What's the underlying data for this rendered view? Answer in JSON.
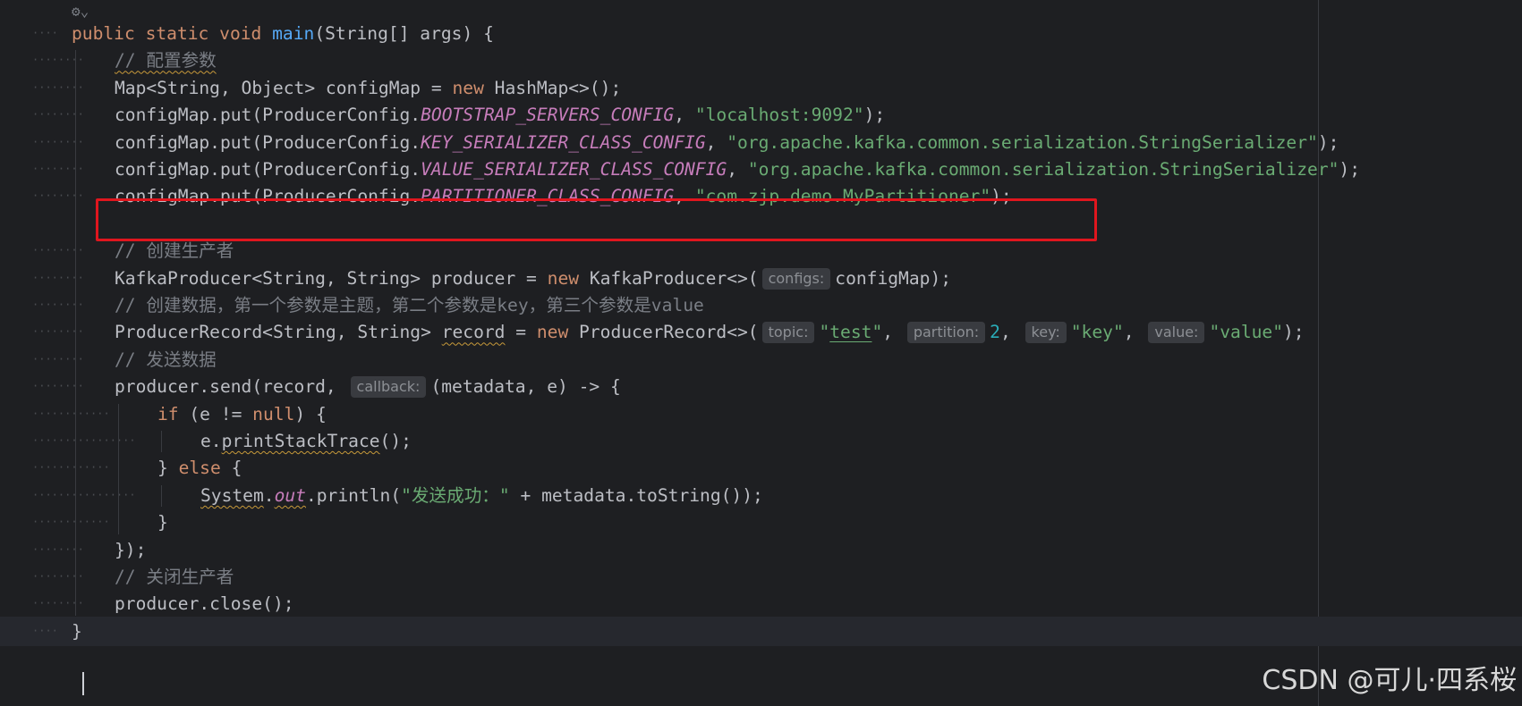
{
  "editor": {
    "colors": {
      "background": "#1e1f22",
      "keyword": "#cf8e6d",
      "method": "#56a8f5",
      "string": "#6aab73",
      "constant": "#c77dbb",
      "number": "#2aacb8",
      "comment": "#7a7e85",
      "highlight_box": "#e0161e"
    },
    "gutter_icon": "run-gutter-icon",
    "lines": [
      {
        "depth": 0,
        "tokens": [
          {
            "t": "public",
            "c": "kw"
          },
          {
            "t": " "
          },
          {
            "t": "static",
            "c": "kw"
          },
          {
            "t": " "
          },
          {
            "t": "void",
            "c": "kw"
          },
          {
            "t": " "
          },
          {
            "t": "main",
            "c": "fn"
          },
          {
            "t": "(String[] args) {"
          }
        ]
      },
      {
        "depth": 1,
        "tokens": [
          {
            "t": "// 配置参数",
            "c": "cmt",
            "squig": true
          }
        ]
      },
      {
        "depth": 1,
        "tokens": [
          {
            "t": "Map<String, Object> configMap = "
          },
          {
            "t": "new",
            "c": "kw"
          },
          {
            "t": " HashMap<>();"
          }
        ]
      },
      {
        "depth": 1,
        "tokens": [
          {
            "t": "configMap.put(ProducerConfig."
          },
          {
            "t": "BOOTSTRAP_SERVERS_CONFIG",
            "c": "cst"
          },
          {
            "t": ", "
          },
          {
            "t": "\"localhost:9092\"",
            "c": "str"
          },
          {
            "t": ");"
          }
        ]
      },
      {
        "depth": 1,
        "tokens": [
          {
            "t": "configMap.put(ProducerConfig."
          },
          {
            "t": "KEY_SERIALIZER_CLASS_CONFIG",
            "c": "cst"
          },
          {
            "t": ", "
          },
          {
            "t": "\"org.apache.kafka.common.serialization.StringSerializer\"",
            "c": "str"
          },
          {
            "t": ");"
          }
        ]
      },
      {
        "depth": 1,
        "tokens": [
          {
            "t": "configMap.put(ProducerConfig."
          },
          {
            "t": "VALUE_SERIALIZER_CLASS_CONFIG",
            "c": "cst"
          },
          {
            "t": ", "
          },
          {
            "t": "\"org.apache.kafka.common.serialization.StringSerializer\"",
            "c": "str"
          },
          {
            "t": ");"
          }
        ]
      },
      {
        "depth": 1,
        "tokens": [
          {
            "t": "configMap.put(ProducerConfig."
          },
          {
            "t": "PARTITIONER_CLASS_CONFIG",
            "c": "cst"
          },
          {
            "t": ", "
          },
          {
            "t": "\"com.zjp.demo.MyPartitioner\"",
            "c": "str"
          },
          {
            "t": ");"
          }
        ]
      },
      {
        "depth": 1,
        "tokens": []
      },
      {
        "depth": 1,
        "tokens": [
          {
            "t": "// 创建生产者",
            "c": "cmt"
          }
        ]
      },
      {
        "depth": 1,
        "tokens": [
          {
            "t": "KafkaProducer<String, String> producer = "
          },
          {
            "t": "new",
            "c": "kw"
          },
          {
            "t": " KafkaProducer<>("
          },
          {
            "hint": "configs:"
          },
          {
            "t": "configMap);"
          }
        ]
      },
      {
        "depth": 1,
        "tokens": [
          {
            "t": "// 创建数据，第一个参数是主题，第二个参数是key，第三个参数是value",
            "c": "cmt"
          }
        ]
      },
      {
        "depth": 1,
        "tokens": [
          {
            "t": "ProducerRecord<String, String> "
          },
          {
            "t": "record",
            "squig": true
          },
          {
            "t": " = "
          },
          {
            "t": "new",
            "c": "kw"
          },
          {
            "t": " ProducerRecord<>("
          },
          {
            "hint": "topic:"
          },
          {
            "t": "\"",
            "c": "str"
          },
          {
            "t": "test",
            "c": "str",
            "uline": true
          },
          {
            "t": "\"",
            "c": "str"
          },
          {
            "t": ", "
          },
          {
            "hint": "partition:"
          },
          {
            "t": "2",
            "c": "num"
          },
          {
            "t": ", "
          },
          {
            "hint": "key:"
          },
          {
            "t": "\"key\"",
            "c": "str"
          },
          {
            "t": ", "
          },
          {
            "hint": "value:"
          },
          {
            "t": "\"value\"",
            "c": "str"
          },
          {
            "t": ");"
          }
        ]
      },
      {
        "depth": 1,
        "tokens": [
          {
            "t": "// 发送数据",
            "c": "cmt"
          }
        ]
      },
      {
        "depth": 1,
        "tokens": [
          {
            "t": "producer.send(record, "
          },
          {
            "hint": "callback:"
          },
          {
            "t": "(metadata, e) -> {"
          }
        ]
      },
      {
        "depth": 2,
        "tokens": [
          {
            "t": "if",
            "c": "kw"
          },
          {
            "t": " (e != "
          },
          {
            "t": "null",
            "c": "kw"
          },
          {
            "t": ") {"
          }
        ]
      },
      {
        "depth": 3,
        "tokens": [
          {
            "t": "e."
          },
          {
            "t": "printStackTrace",
            "squig": true
          },
          {
            "t": "();"
          }
        ]
      },
      {
        "depth": 2,
        "tokens": [
          {
            "t": "} "
          },
          {
            "t": "else",
            "c": "kw"
          },
          {
            "t": " {"
          }
        ]
      },
      {
        "depth": 3,
        "tokens": [
          {
            "t": "System",
            "squig": true
          },
          {
            "t": "."
          },
          {
            "t": "out",
            "c": "cst",
            "squig": true
          },
          {
            "t": ".println("
          },
          {
            "t": "\"发送成功：\"",
            "c": "str"
          },
          {
            "t": " + metadata.toString());"
          }
        ]
      },
      {
        "depth": 2,
        "tokens": [
          {
            "t": "}"
          }
        ]
      },
      {
        "depth": 1,
        "tokens": [
          {
            "t": "});"
          }
        ]
      },
      {
        "depth": 1,
        "tokens": [
          {
            "t": "// 关闭生产者",
            "c": "cmt"
          }
        ]
      },
      {
        "depth": 1,
        "tokens": [
          {
            "t": "producer.close();"
          }
        ]
      },
      {
        "depth": 0,
        "tokens": [
          {
            "t": "}"
          }
        ],
        "current": true
      }
    ]
  },
  "watermark": "CSDN @可儿·四系桜"
}
